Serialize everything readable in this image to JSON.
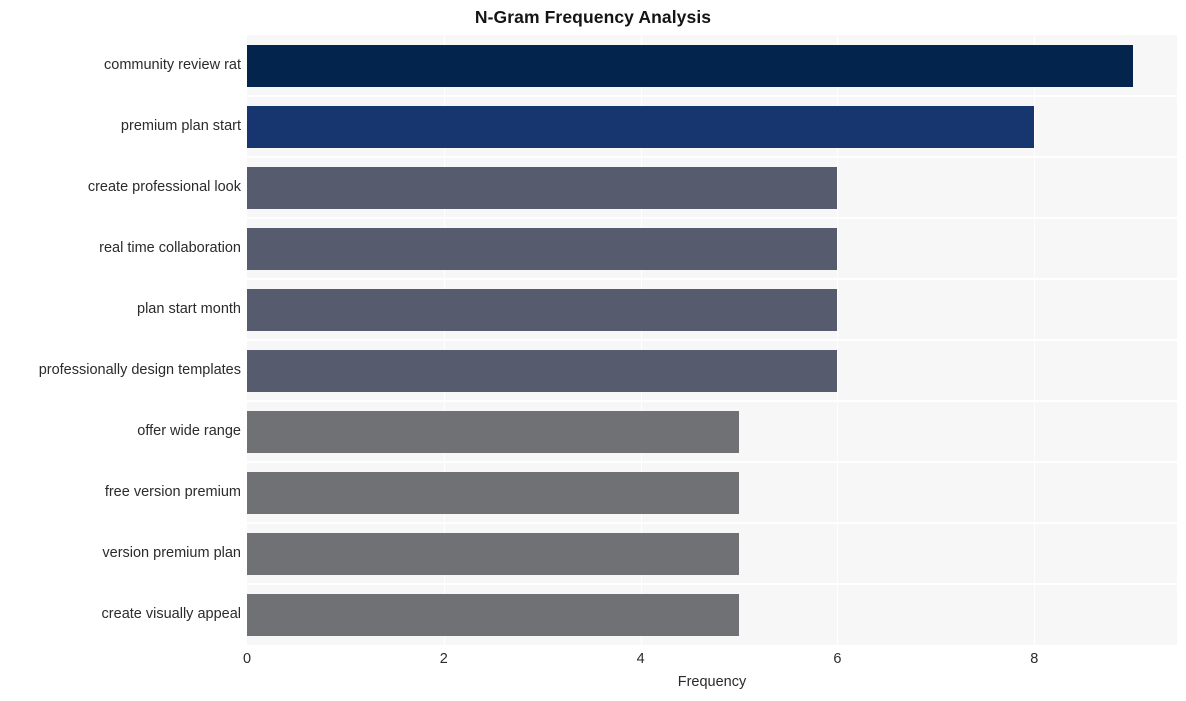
{
  "chart_data": {
    "type": "bar",
    "orientation": "horizontal",
    "title": "N-Gram Frequency Analysis",
    "xlabel": "Frequency",
    "ylabel": "",
    "categories": [
      "community review rat",
      "premium plan start",
      "create professional look",
      "real time collaboration",
      "plan start month",
      "professionally design templates",
      "offer wide range",
      "free version premium",
      "version premium plan",
      "create visually appeal"
    ],
    "values": [
      9,
      8,
      6,
      6,
      6,
      6,
      5,
      5,
      5,
      5
    ],
    "bar_colors": [
      "#03244d",
      "#173670",
      "#565c6d",
      "#565c6d",
      "#565c6d",
      "#565c6d",
      "#707174",
      "#707174",
      "#707174",
      "#707174"
    ],
    "xlim": [
      0,
      9.45
    ],
    "xticks": [
      0,
      2,
      4,
      6,
      8
    ],
    "xtick_labels": [
      "0",
      "2",
      "4",
      "6",
      "8"
    ],
    "grid": true,
    "grid_color": "#ffffff",
    "plot_background": "#f7f7f8",
    "figure_background": "#ffffff",
    "legend": null,
    "legend_position": "none"
  }
}
